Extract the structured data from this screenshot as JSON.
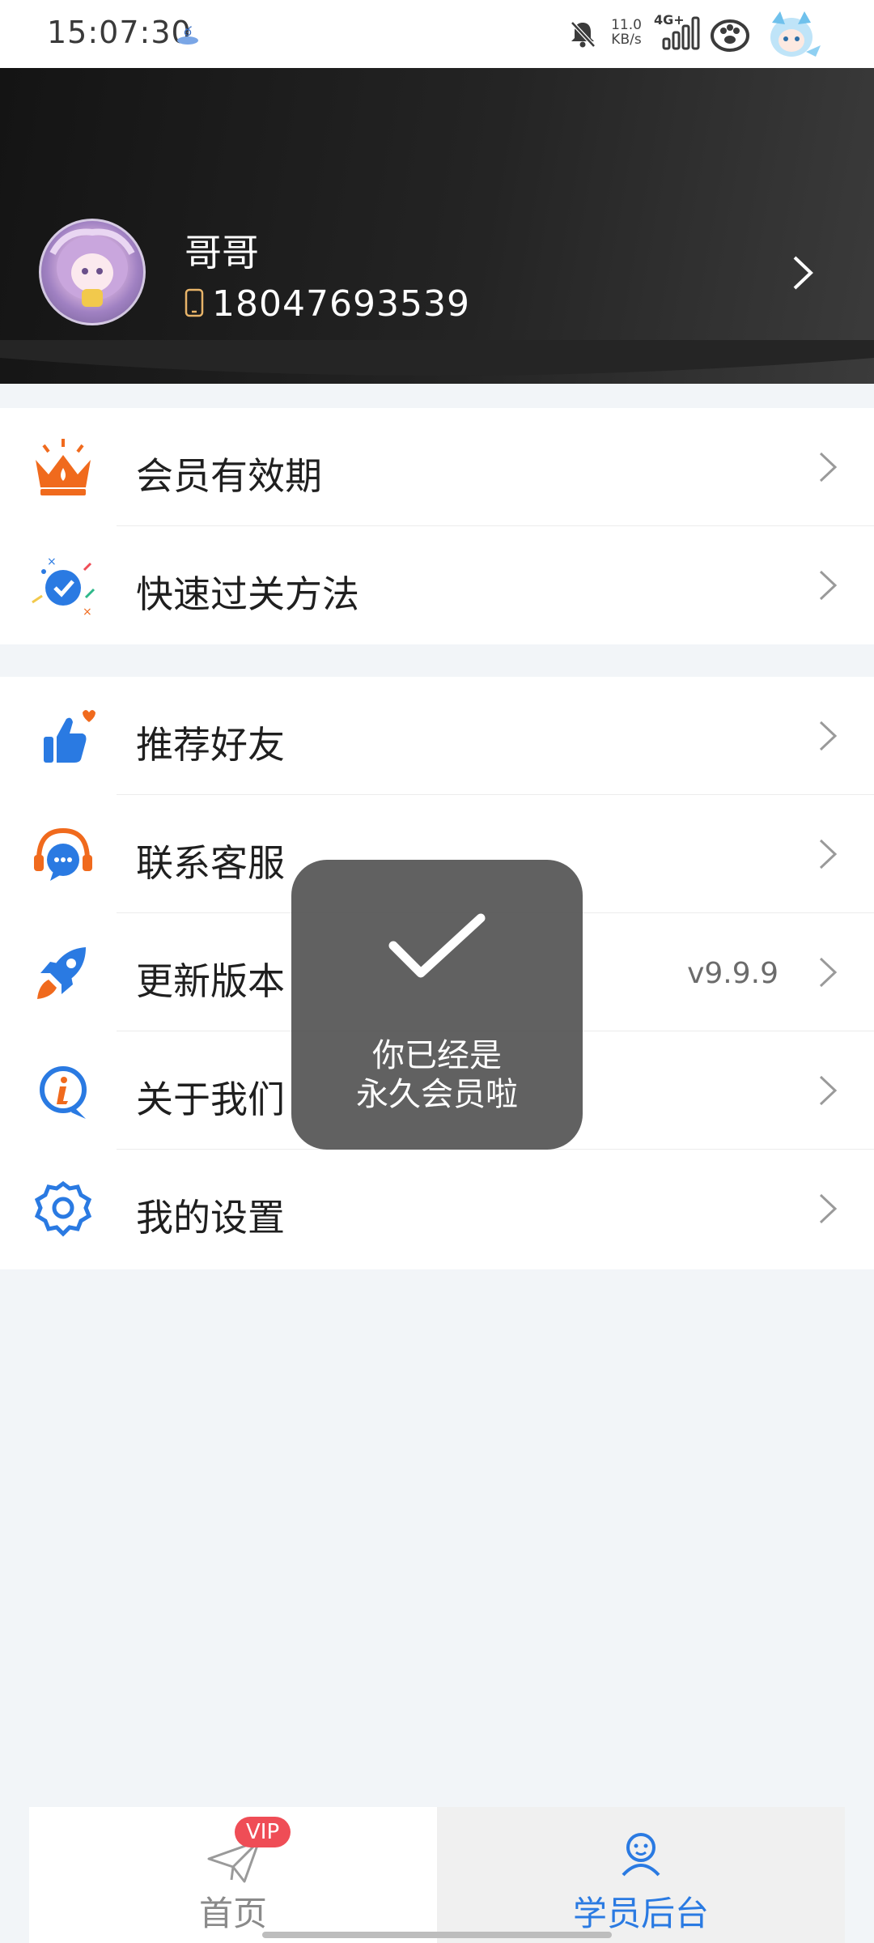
{
  "status_bar": {
    "time": "15:07:30",
    "net_speed_value": "11.0",
    "net_speed_unit": "KB/s",
    "network_type": "4G+"
  },
  "profile": {
    "name": "哥哥",
    "phone": "18047693539"
  },
  "menu": {
    "group1": [
      {
        "label": "会员有效期",
        "icon": "crown-icon"
      },
      {
        "label": "快速过关方法",
        "icon": "check-badge-icon"
      }
    ],
    "group2": [
      {
        "label": "推荐好友",
        "icon": "thumbs-up-icon"
      },
      {
        "label": "联系客服",
        "icon": "headset-icon"
      },
      {
        "label": "更新版本",
        "icon": "rocket-icon",
        "value": "v9.9.9"
      },
      {
        "label": "关于我们",
        "icon": "info-icon"
      },
      {
        "label": "我的设置",
        "icon": "settings-gear-icon"
      }
    ]
  },
  "toast": {
    "line1": "你已经是",
    "line2": "永久会员啦"
  },
  "bottom_nav": {
    "home_label": "首页",
    "home_badge": "VIP",
    "student_label": "学员后台",
    "active_color": "#2a7ae2",
    "inactive_color": "#8a8a8a"
  },
  "colors": {
    "accent_blue": "#2a7ae2",
    "crown_orange": "#f06a1d",
    "badge_red": "#ef4d56"
  }
}
